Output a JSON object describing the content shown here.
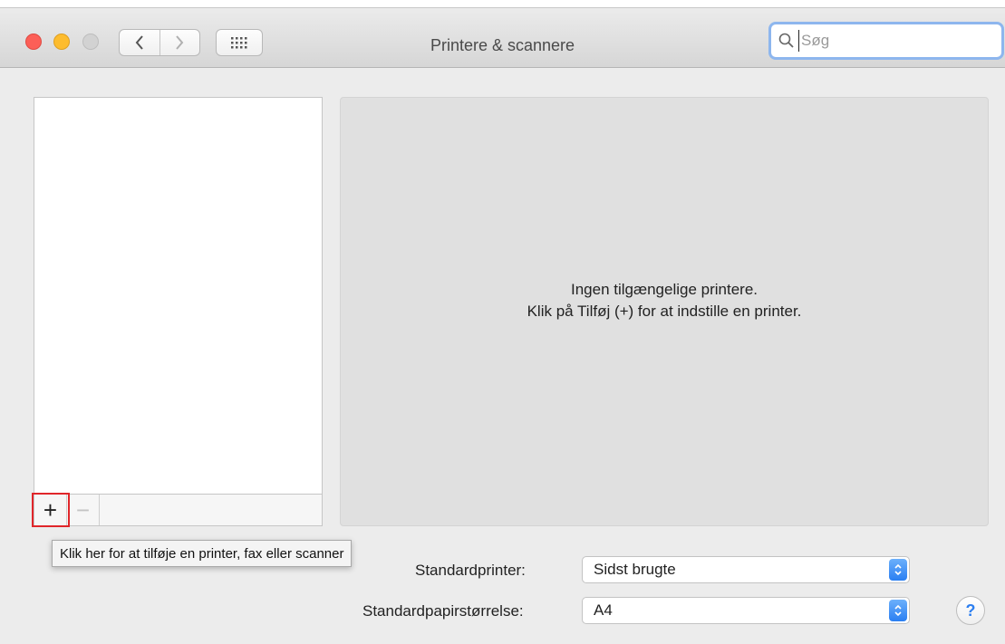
{
  "window": {
    "title": "Printere & scannere"
  },
  "toolbar": {
    "back_icon": "chevron-left-icon",
    "forward_icon": "chevron-right-icon",
    "show_all_icon": "grid-icon"
  },
  "search": {
    "placeholder": "Søg",
    "value": ""
  },
  "printer_list": {
    "items": [],
    "add_label": "+",
    "remove_label": "−",
    "add_tooltip": "Klik her for at tilføje en printer, fax eller scanner"
  },
  "detail": {
    "empty_line1": "Ingen tilgængelige printere.",
    "empty_line2": "Klik på Tilføj (+) for at indstille en printer."
  },
  "settings": {
    "default_printer_label": "Standardprinter:",
    "default_printer_value": "Sidst brugte",
    "paper_size_label": "Standardpapirstørrelse:",
    "paper_size_value": "A4"
  },
  "help_label": "?",
  "colors": {
    "accent": "#2a7ff2",
    "highlight": "#e0262a",
    "close": "#fc5f57",
    "minimize": "#fdbc2e"
  }
}
